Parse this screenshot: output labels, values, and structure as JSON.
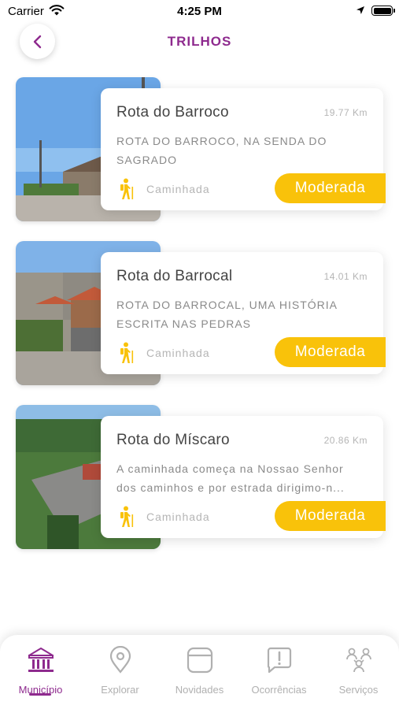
{
  "status_bar": {
    "carrier": "Carrier",
    "time": "4:25 PM"
  },
  "header": {
    "title": "TRILHOS",
    "back_icon": "chevron-left-icon"
  },
  "colors": {
    "accent": "#8e2a8e",
    "difficulty": "#f9c20a",
    "hiker": "#f9c20a"
  },
  "trails": [
    {
      "name": "Rota do Barroco",
      "distance": "19.77 Km",
      "description": "ROTA DO BARROCO, NA SENDA DO SAGRADO",
      "type": "Caminhada",
      "difficulty": "Moderada"
    },
    {
      "name": "Rota do Barrocal",
      "distance": "14.01 Km",
      "description": "ROTA DO BARROCAL, UMA HISTÓRIA ESCRITA NAS PEDRAS",
      "type": "Caminhada",
      "difficulty": "Moderada"
    },
    {
      "name": "Rota do Míscaro",
      "distance": "20.86 Km",
      "description": "A caminhada começa na Nossao Senhor dos caminhos e por estrada dirigimo-n...",
      "type": "Caminhada",
      "difficulty": "Moderada"
    }
  ],
  "tabs": [
    {
      "label": "Município",
      "icon": "town-hall-icon",
      "active": true
    },
    {
      "label": "Explorar",
      "icon": "map-pin-icon",
      "active": false
    },
    {
      "label": "Novidades",
      "icon": "news-icon",
      "active": false
    },
    {
      "label": "Ocorrências",
      "icon": "alert-message-icon",
      "active": false
    },
    {
      "label": "Serviços",
      "icon": "services-icon",
      "active": false
    }
  ]
}
